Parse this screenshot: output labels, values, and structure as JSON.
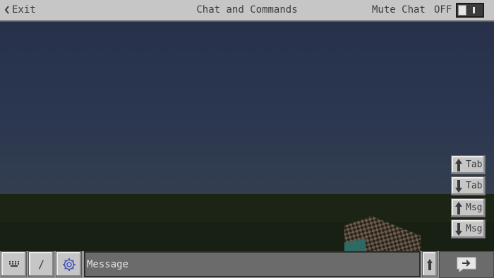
{
  "topbar": {
    "exit_label": "Exit",
    "title": "Chat and Commands",
    "mute_label": "Mute Chat",
    "mute_state": "OFF"
  },
  "side_buttons": [
    {
      "label": "Tab",
      "direction": "up",
      "icon": "arrow-up-icon"
    },
    {
      "label": "Tab",
      "direction": "down",
      "icon": "arrow-down-icon"
    },
    {
      "label": "Msg",
      "direction": "up",
      "icon": "arrow-up-icon"
    },
    {
      "label": "Msg",
      "direction": "down",
      "icon": "arrow-down-icon"
    }
  ],
  "bottombar": {
    "keyboard_icon": "keyboard-icon",
    "slash_label": "/",
    "settings_icon": "gear-icon",
    "message_placeholder": "Message",
    "history_icon": "arrow-up-icon",
    "send_icon": "send-icon"
  },
  "colors": {
    "panel": "#c6c6c6",
    "sky_top": "#27314a",
    "ground": "#1c2415",
    "input_bg": "#6b6b6b"
  }
}
